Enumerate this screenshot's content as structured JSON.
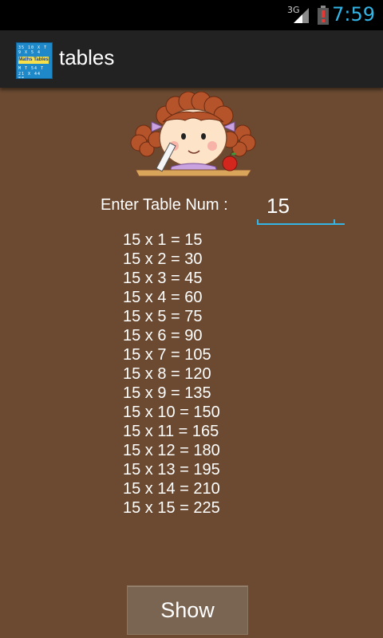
{
  "status_bar": {
    "network": "3G",
    "time": "7:59",
    "accent_color": "#33b5e5"
  },
  "action_bar": {
    "title": "tables",
    "icon": {
      "name": "maths-tables-app-icon",
      "label": "Maths Tables"
    }
  },
  "form": {
    "label": "Enter Table Num :",
    "value": "15"
  },
  "results": [
    "15 x 1 = 15",
    "15 x 2 = 30",
    "15 x 3 = 45",
    "15 x 4 = 60",
    "15 x 5 = 75",
    "15 x 6 = 90",
    "15 x 7 = 105",
    "15 x 8 = 120",
    "15 x 9 = 135",
    "15 x 10 = 150",
    "15 x 11 = 165",
    "15 x 12 = 180",
    "15 x 13 = 195",
    "15 x 14 = 210",
    "15 x 15 = 225"
  ],
  "show_button": {
    "label": "Show"
  },
  "colors": {
    "background": "#6b4a31",
    "action_bar": "#222222",
    "button": "#7a6552"
  }
}
